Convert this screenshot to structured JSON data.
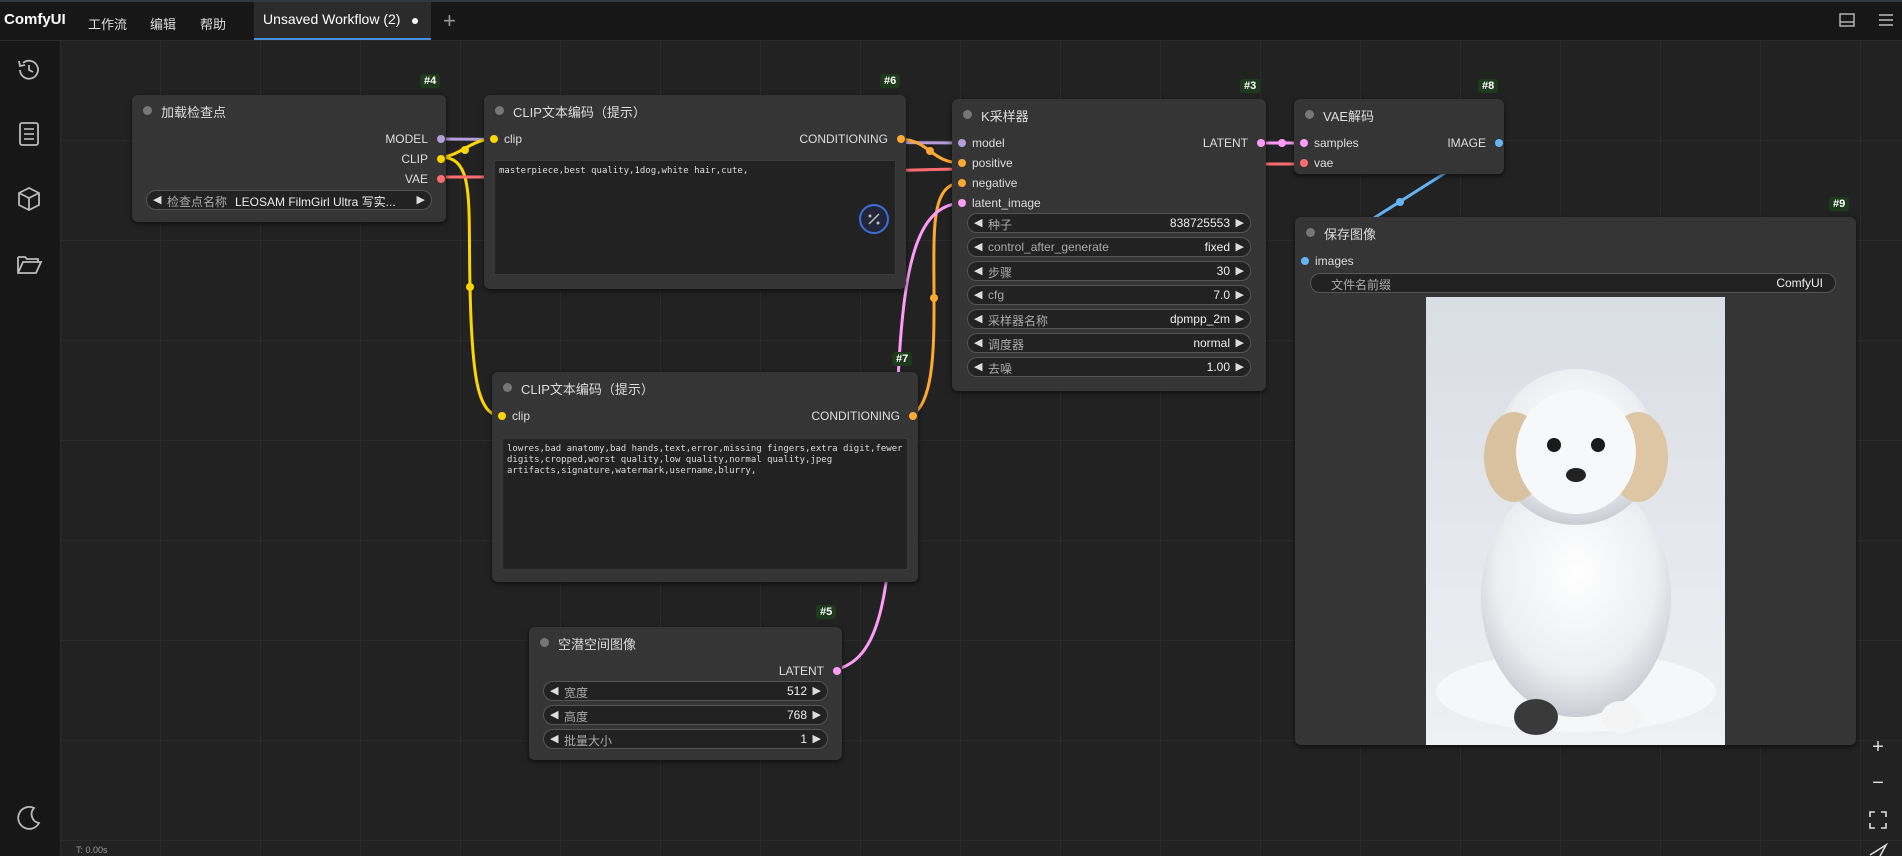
{
  "topbar": {
    "logo": "ComfyUI",
    "menu": [
      "工作流",
      "编辑",
      "帮助"
    ],
    "tab_label": "Unsaved Workflow (2)"
  },
  "nodes": {
    "n4": {
      "id": "#4",
      "title": "加载检查点",
      "outputs": [
        "MODEL",
        "CLIP",
        "VAE"
      ],
      "widget_label": "检查点名称",
      "widget_value": "LEOSAM FilmGirl Ultra 写实..."
    },
    "n6": {
      "id": "#6",
      "title": "CLIP文本编码（提示）",
      "input": "clip",
      "output": "CONDITIONING",
      "text": "masterpiece,best quality,1dog,white hair,cute,"
    },
    "n7": {
      "id": "#7",
      "title": "CLIP文本编码（提示）",
      "input": "clip",
      "output": "CONDITIONING",
      "text": "lowres,bad anatomy,bad hands,text,error,missing fingers,extra digit,fewer\ndigits,cropped,worst quality,low quality,normal quality,jpeg\nartifacts,signature,watermark,username,blurry,"
    },
    "n3": {
      "id": "#3",
      "title": "K采样器",
      "inputs": [
        "model",
        "positive",
        "negative",
        "latent_image"
      ],
      "output": "LATENT",
      "widgets": [
        {
          "label": "种子",
          "value": "838725553"
        },
        {
          "label": "control_after_generate",
          "value": "fixed"
        },
        {
          "label": "步骤",
          "value": "30"
        },
        {
          "label": "cfg",
          "value": "7.0"
        },
        {
          "label": "采样器名称",
          "value": "dpmpp_2m"
        },
        {
          "label": "调度器",
          "value": "normal"
        },
        {
          "label": "去噪",
          "value": "1.00"
        }
      ]
    },
    "n8": {
      "id": "#8",
      "title": "VAE解码",
      "inputs": [
        "samples",
        "vae"
      ],
      "output": "IMAGE"
    },
    "n9": {
      "id": "#9",
      "title": "保存图像",
      "input": "images",
      "widget_label": "文件名前缀",
      "widget_value": "ComfyUI"
    },
    "n5": {
      "id": "#5",
      "title": "空潜空间图像",
      "output": "LATENT",
      "widgets": [
        {
          "label": "宽度",
          "value": "512"
        },
        {
          "label": "高度",
          "value": "768"
        },
        {
          "label": "批量大小",
          "value": "1"
        }
      ]
    }
  },
  "status": "T: 0.00s",
  "colors": {
    "model": "#b39ddb",
    "clip": "#ffd500",
    "vae": "#ff6e6e",
    "conditioning": "#ffa931",
    "latent": "#ff9cf9",
    "image": "#64b5f6",
    "accent": "#4a8ce0"
  },
  "icons": [
    "history-icon",
    "queue-icon",
    "cube-icon",
    "folder-open-icon",
    "moon-icon",
    "panel-icon",
    "hamburger-icon",
    "zoom-in-icon",
    "zoom-out-icon",
    "fit-view-icon",
    "link-icon"
  ]
}
